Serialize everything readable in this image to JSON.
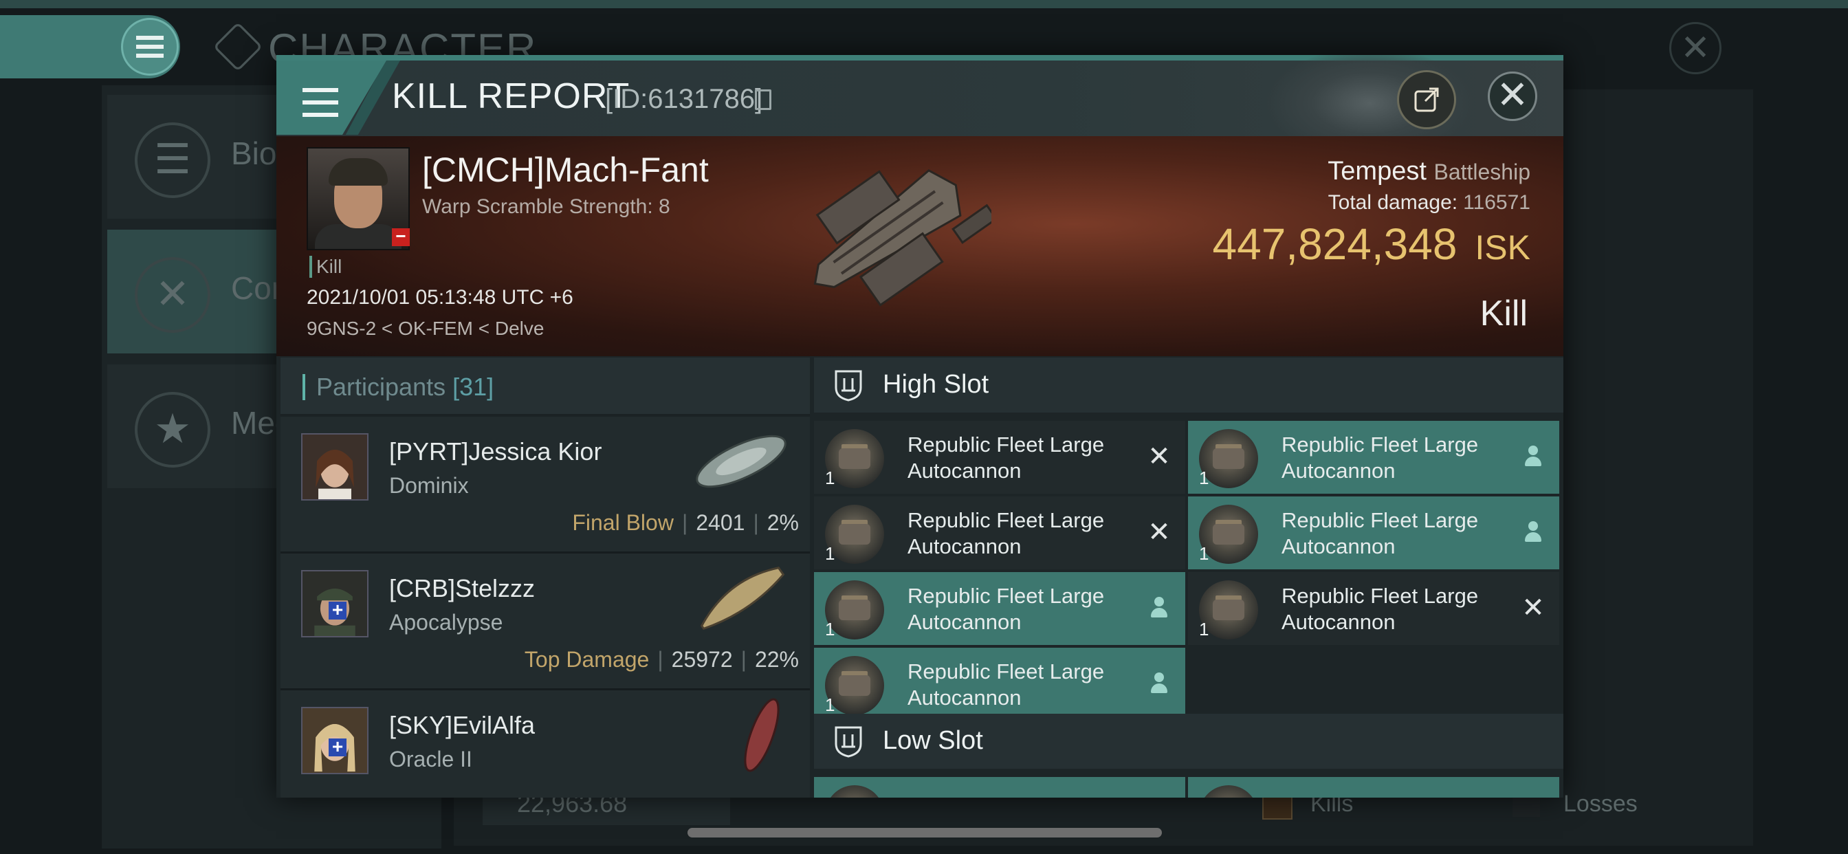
{
  "background": {
    "title": "CHARACTER",
    "menu_rows": [
      {
        "label": "Bio",
        "icon": "list-icon"
      },
      {
        "label": "Com",
        "icon": "crossed-swords-icon"
      },
      {
        "label": "Med",
        "icon": "star-icon"
      }
    ],
    "stat_value": "22,963.68",
    "kills_label": "Kills",
    "losses_label": "Losses"
  },
  "modal": {
    "title": "KILL REPORT",
    "id_text": "[ID:6131786]"
  },
  "victim": {
    "name": "[CMCH]Mach-Fant",
    "scram": "Warp Scramble Strength: 8",
    "kill_tag": "Kill",
    "datetime": "2021/10/01 05:13:48 UTC +6",
    "location": "9GNS-2 < OK-FEM < Delve",
    "ship": "Tempest",
    "ship_class": "Battleship",
    "total_damage_label": "Total damage:",
    "total_damage": "116571",
    "isk_value": "447,824,348",
    "isk_unit": "ISK",
    "result": "Kill"
  },
  "participants": {
    "label": "Participants",
    "count": "[31]",
    "items": [
      {
        "name": "[PYRT]Jessica Kior",
        "ship": "Dominix",
        "tag": "Final Blow",
        "damage": "2401",
        "percent": "2%"
      },
      {
        "name": "[CRB]Stelzzz",
        "ship": "Apocalypse",
        "tag": "Top Damage",
        "damage": "25972",
        "percent": "22%"
      },
      {
        "name": "[SKY]EvilAlfa",
        "ship": "Oracle II",
        "tag": "",
        "damage": "",
        "percent": ""
      }
    ]
  },
  "high_slot": {
    "title": "High Slot",
    "items": [
      {
        "name": "Republic Fleet Large Autocannon",
        "qty": "1",
        "state": "destroyed"
      },
      {
        "name": "Republic Fleet Large Autocannon",
        "qty": "1",
        "state": "dropped"
      },
      {
        "name": "Republic Fleet Large Autocannon",
        "qty": "1",
        "state": "destroyed"
      },
      {
        "name": "Republic Fleet Large Autocannon",
        "qty": "1",
        "state": "dropped"
      },
      {
        "name": "Republic Fleet Large Autocannon",
        "qty": "1",
        "state": "dropped"
      },
      {
        "name": "Republic Fleet Large Autocannon",
        "qty": "1",
        "state": "destroyed"
      },
      {
        "name": "Republic Fleet Large Autocannon",
        "qty": "1",
        "state": "dropped"
      }
    ]
  },
  "low_slot": {
    "title": "Low Slot"
  },
  "colors": {
    "accent": "#3d776f",
    "isk": "#e7c36f",
    "final_blow": "#c2a56a"
  }
}
